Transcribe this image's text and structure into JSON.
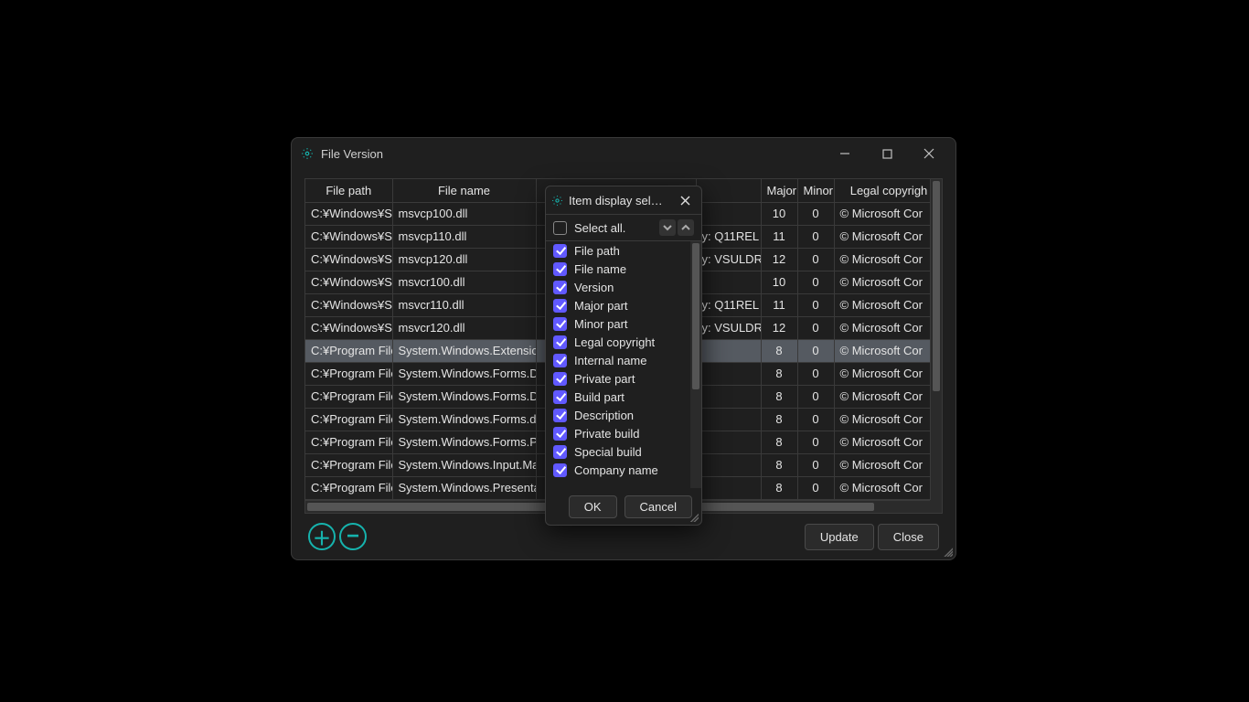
{
  "window": {
    "title": "File Version"
  },
  "table": {
    "columns": {
      "path": "File path",
      "name": "File name",
      "major": "Major p",
      "minor": "Minor",
      "copy": "Legal copyrigh"
    },
    "rows": [
      {
        "path": "C:¥Windows¥Sy",
        "name": "msvcp100.dll",
        "extra": "",
        "major": "10",
        "minor": "0",
        "copy": "© Microsoft Cor"
      },
      {
        "path": "C:¥Windows¥Sy",
        "name": "msvcp110.dll",
        "extra": "y: Q11REL",
        "major": "11",
        "minor": "0",
        "copy": "© Microsoft Cor"
      },
      {
        "path": "C:¥Windows¥Sy",
        "name": "msvcp120.dll",
        "extra": "y: VSULDR",
        "major": "12",
        "minor": "0",
        "copy": "© Microsoft Cor"
      },
      {
        "path": "C:¥Windows¥Sy",
        "name": "msvcr100.dll",
        "extra": "",
        "major": "10",
        "minor": "0",
        "copy": "© Microsoft Cor"
      },
      {
        "path": "C:¥Windows¥Sy",
        "name": "msvcr110.dll",
        "extra": "y: Q11REL",
        "major": "11",
        "minor": "0",
        "copy": "© Microsoft Cor"
      },
      {
        "path": "C:¥Windows¥Sy",
        "name": "msvcr120.dll",
        "extra": "y: VSULDR",
        "major": "12",
        "minor": "0",
        "copy": "© Microsoft Cor"
      },
      {
        "path": "C:¥Program File",
        "name": "System.Windows.Extensions.",
        "extra": "",
        "major": "8",
        "minor": "0",
        "copy": "© Microsoft Cor",
        "selected": true
      },
      {
        "path": "C:¥Program File",
        "name": "System.Windows.Forms.Desig",
        "extra": "",
        "major": "8",
        "minor": "0",
        "copy": "© Microsoft Cor"
      },
      {
        "path": "C:¥Program File",
        "name": "System.Windows.Forms.Desig",
        "extra": "",
        "major": "8",
        "minor": "0",
        "copy": "© Microsoft Cor"
      },
      {
        "path": "C:¥Program File",
        "name": "System.Windows.Forms.dll",
        "extra": "",
        "major": "8",
        "minor": "0",
        "copy": "© Microsoft Cor"
      },
      {
        "path": "C:¥Program File",
        "name": "System.Windows.Forms.Primi",
        "extra": "",
        "major": "8",
        "minor": "0",
        "copy": "© Microsoft Cor"
      },
      {
        "path": "C:¥Program File",
        "name": "System.Windows.Input.Manip",
        "extra": "",
        "major": "8",
        "minor": "0",
        "copy": "© Microsoft Cor"
      },
      {
        "path": "C:¥Program File",
        "name": "System.Windows.Presentatio",
        "extra": "",
        "major": "8",
        "minor": "0",
        "copy": "© Microsoft Cor"
      }
    ]
  },
  "footer": {
    "update": "Update",
    "close": "Close"
  },
  "dialog": {
    "title": "Item display selecti…",
    "select_all": "Select all.",
    "options": [
      "File path",
      "File name",
      "Version",
      "Major part",
      "Minor part",
      "Legal copyright",
      "Internal name",
      "Private part",
      "Build part",
      "Description",
      "Private build",
      "Special build",
      "Company name"
    ],
    "ok": "OK",
    "cancel": "Cancel"
  }
}
